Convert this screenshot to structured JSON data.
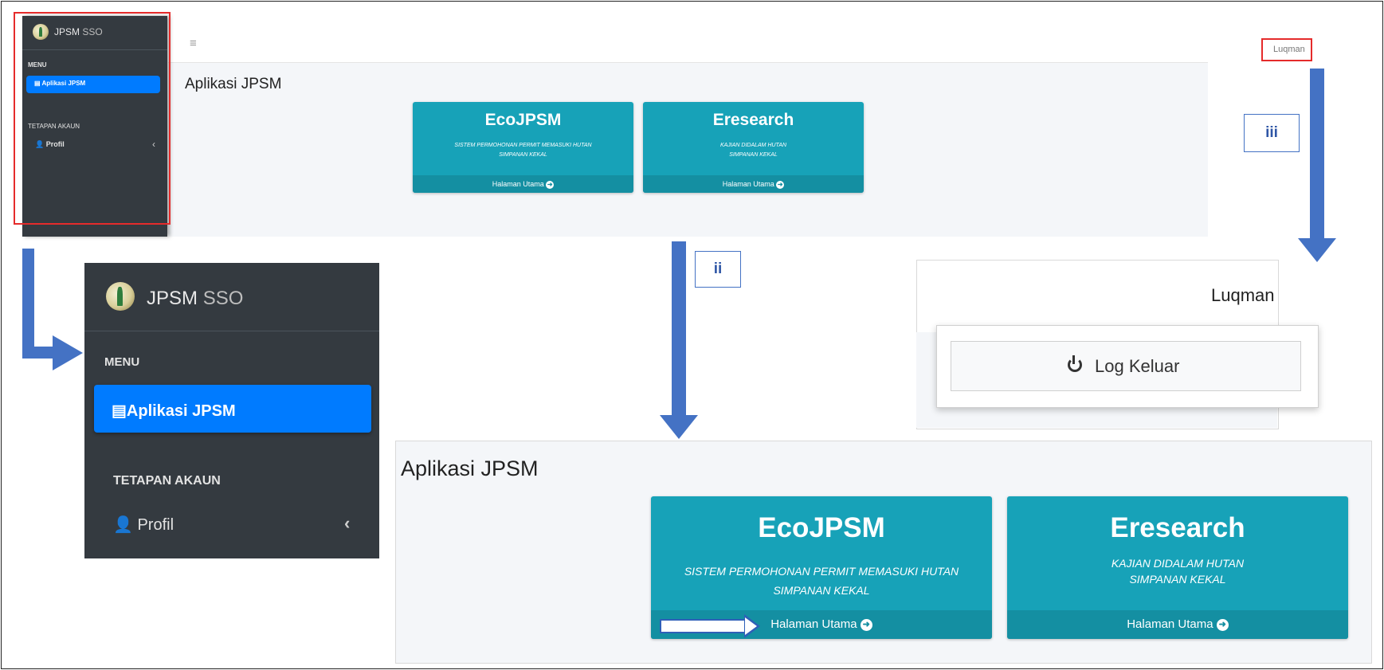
{
  "app": {
    "brand_prefix": "JPSM",
    "brand_suffix": "SSO",
    "page_title": "Aplikasi JPSM"
  },
  "user": {
    "name": "Luqman"
  },
  "topbar": {
    "menu_icon": "hamburger-icon"
  },
  "sidebar": {
    "menu_header": "MENU",
    "active_item": {
      "label": "Aplikasi JPSM",
      "icon": "table-list-icon"
    },
    "account_header": "TETAPAN AKAUN",
    "profile_item": {
      "label": "Profil",
      "icon": "user-icon",
      "chevron": "‹"
    }
  },
  "cards": [
    {
      "title": "EcoJPSM",
      "description_lines": [
        "SISTEM PERMOHONAN PERMIT MEMASUKI HUTAN",
        "SIMPANAN KEKAL"
      ],
      "footer": "Halaman Utama",
      "footer_icon": "arrow-circle-right-icon"
    },
    {
      "title": "Eresearch",
      "description_lines": [
        "KAJIAN DIDALAM HUTAN",
        "SIMPANAN KEKAL"
      ],
      "footer": "Halaman Utama",
      "footer_icon": "arrow-circle-right-icon"
    }
  ],
  "dropdown": {
    "logout_label": "Log Keluar",
    "logout_icon": "power-icon"
  },
  "callouts": {
    "ii": "ii",
    "iii": "iii"
  },
  "colors": {
    "sidebar_bg": "#343a40",
    "active_blue": "#007bff",
    "card_teal": "#17a2b8",
    "card_footer": "#148fa2",
    "arrow_blue": "#4472c4",
    "highlight_red": "#e52b2b"
  }
}
